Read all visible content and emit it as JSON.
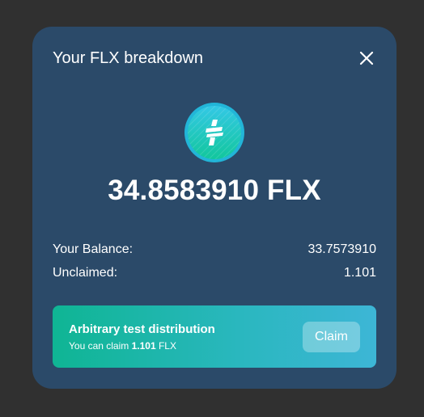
{
  "modal": {
    "title": "Your FLX breakdown",
    "close_icon": "close-icon",
    "token_icon": "flx-token-icon",
    "total": "34.8583910 FLX"
  },
  "breakdown": {
    "balance_label": "Your Balance:",
    "balance_value": "33.7573910",
    "unclaimed_label": "Unclaimed:",
    "unclaimed_value": "1.101"
  },
  "claim_card": {
    "title": "Arbitrary test distribution",
    "sub_prefix": "You can claim ",
    "amount": "1.101",
    "unit": " FLX",
    "button_label": "Claim"
  },
  "colors": {
    "backdrop": "#303030",
    "modal_bg": "#2b4a69",
    "card_gradient_start": "#0fb594",
    "card_gradient_end": "#3db6d6"
  }
}
